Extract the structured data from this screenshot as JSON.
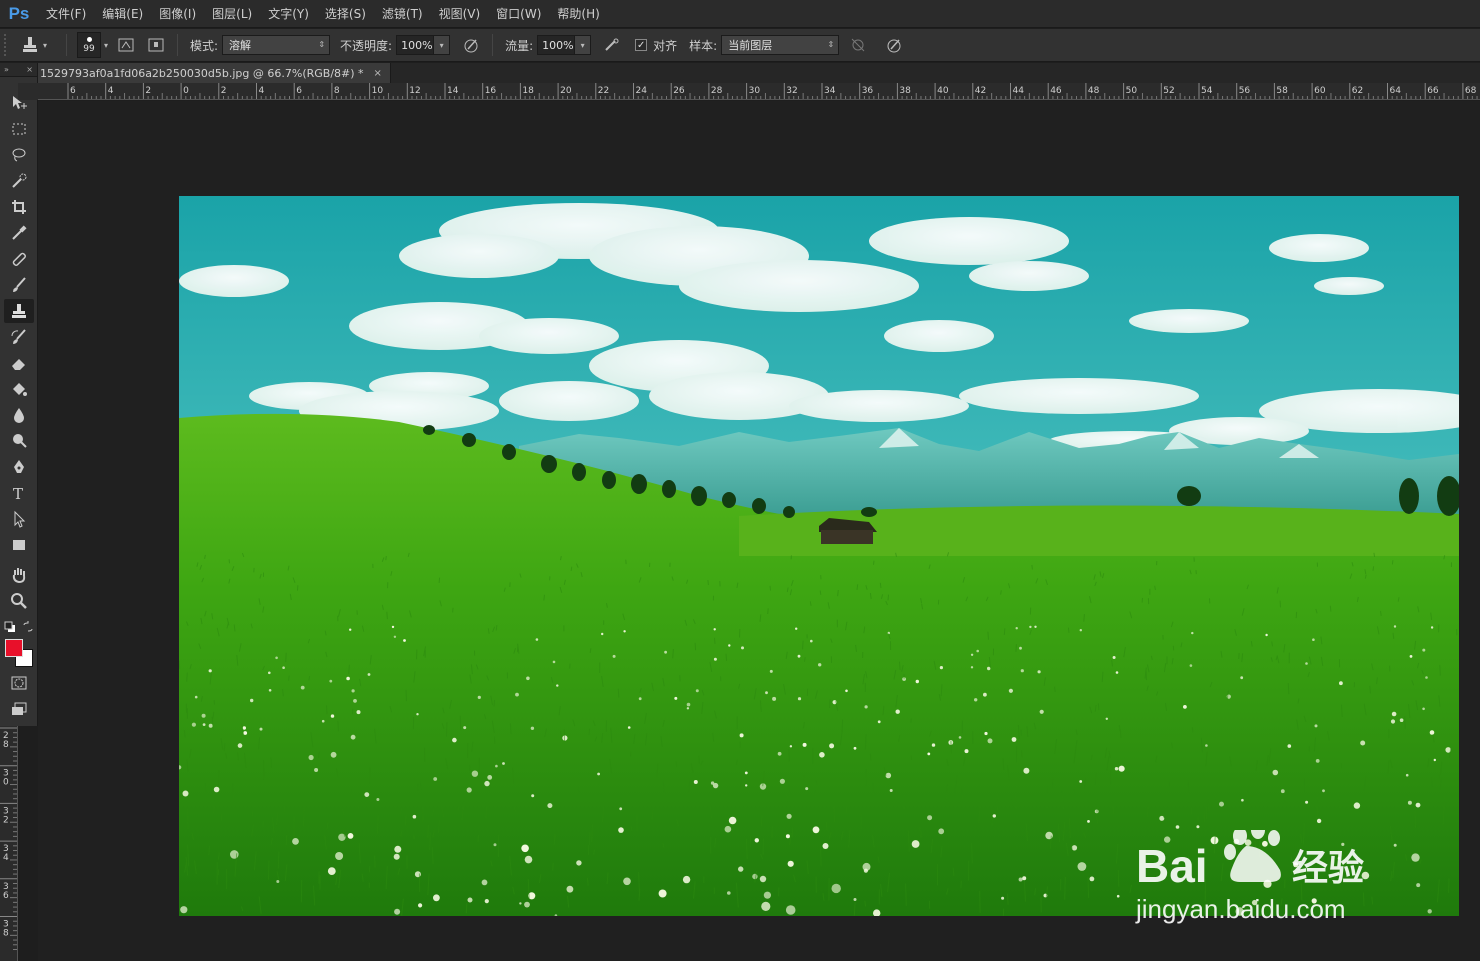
{
  "app": {
    "logo": "Ps"
  },
  "menu": [
    "文件(F)",
    "编辑(E)",
    "图像(I)",
    "图层(L)",
    "文字(Y)",
    "选择(S)",
    "滤镜(T)",
    "视图(V)",
    "窗口(W)",
    "帮助(H)"
  ],
  "options": {
    "brush_size": "99",
    "mode_label": "模式:",
    "mode_value": "溶解",
    "opacity_label": "不透明度:",
    "opacity_value": "100%",
    "flow_label": "流量:",
    "flow_value": "100%",
    "align_label": "对齐",
    "align_checked": true,
    "sample_label": "样本:",
    "sample_value": "当前图层"
  },
  "document": {
    "tab_title": "1529793af0a1fd06a2b250030d5b.jpg @ 66.7%(RGB/8#) *",
    "close": "×"
  },
  "rulers": {
    "horizontal_labels": [
      "6",
      "4",
      "2",
      "0",
      "2",
      "4",
      "6",
      "8",
      "10",
      "12",
      "14",
      "16",
      "18",
      "20",
      "22",
      "24",
      "26",
      "28",
      "30",
      "32",
      "34",
      "36",
      "38",
      "40",
      "42",
      "44",
      "46",
      "48",
      "50",
      "52",
      "54",
      "56",
      "58",
      "60",
      "62",
      "64",
      "66",
      "68"
    ],
    "vertical_labels": [
      "2 8",
      "3 0",
      "3 2",
      "3 4",
      "3 6",
      "3 8"
    ]
  },
  "colors": {
    "foreground": "#e8102a",
    "background": "#ffffff",
    "accent": "#4a9be8"
  },
  "watermark": {
    "brand_latin": "Bai",
    "brand_cn": "经验",
    "url": "jingyan.baidu.com"
  },
  "icons": {
    "tools": [
      "move-icon",
      "marquee-icon",
      "lasso-icon",
      "quick-select-icon",
      "crop-icon",
      "eyedropper-icon",
      "healing-brush-icon",
      "brush-icon",
      "clone-stamp-icon",
      "history-brush-icon",
      "eraser-icon",
      "paint-bucket-icon",
      "blur-icon",
      "dodge-icon",
      "pen-icon",
      "type-icon",
      "path-select-icon",
      "rectangle-icon",
      "hand-icon",
      "zoom-icon"
    ]
  }
}
